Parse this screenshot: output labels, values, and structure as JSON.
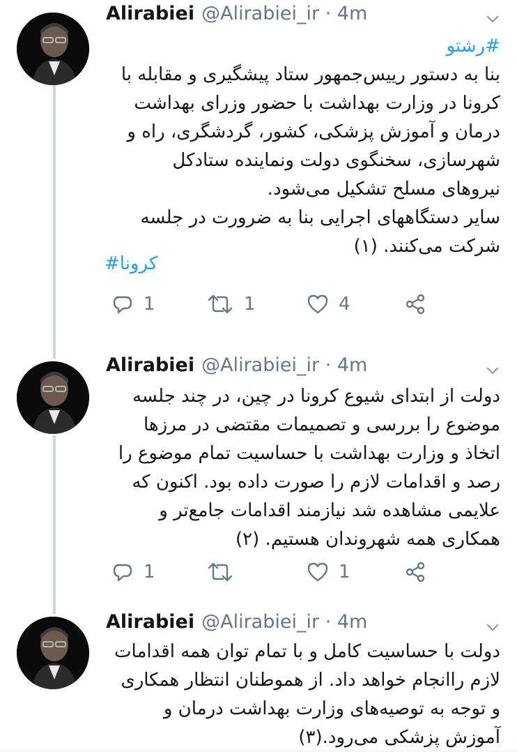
{
  "tweets": [
    {
      "name": "Alirabiei",
      "handle": "@Alirabiei_ir · 4m",
      "hashtag_top": "#رشتو",
      "lines": [
        "بنا به دستور رییس‌جمهور ستاد پیشگیری و مقابله با",
        "کرونا در وزارت بهداشت با حضور وزرای بهداشت",
        "درمان و آموزش پزشکی، کشور، گردشگری، راه و",
        "شهرسازی، سخنگوی دولت ونماینده ستادکل",
        "نیروهای مسلح تشکیل می‌شود.",
        "سایر دستگاههای اجرایی بنا به ضرورت در جلسه",
        "شرکت می‌کنند. (۱)"
      ],
      "hashtag_bottom": "#کرونا",
      "reply_count": "1",
      "retweet_count": "1",
      "like_count": "4"
    },
    {
      "name": "Alirabiei",
      "handle": "@Alirabiei_ir · 4m",
      "lines": [
        "دولت از ابتدای شیوع کرونا در چین، در چند جلسه",
        "موضوع را بررسی و تصمیمات مقتضی در مرزها",
        "اتخاذ و وزارت بهداشت با حساسیت تمام موضوع را",
        "رصد و اقدامات لازم را صورت داده بود. اکنون که",
        "علایمی مشاهده شد نیازمند اقدامات جامع‌تر و",
        "همکاری همه شهروندان هستیم. (۲)"
      ],
      "reply_count": "1",
      "retweet_count": "",
      "like_count": "1"
    },
    {
      "name": "Alirabiei",
      "handle": "@Alirabiei_ir · 4m",
      "lines": [
        "دولت با حساسیت کامل و با تمام توان همه اقدامات",
        "لازم راانجام خواهد داد. از هموطنان انتظار همکاری",
        "و توجه به توصیه‌های وزارت بهداشت درمان و",
        "آموزش پزشکی می‌رود.(۳)"
      ]
    }
  ],
  "icons": {
    "reply": "reply-icon",
    "retweet": "retweet-icon",
    "like": "like-icon",
    "share": "share-icon",
    "more": "chevron-down-icon"
  },
  "colors": {
    "accent": "#1da1f2",
    "muted": "#657786",
    "text": "#14171a",
    "thread_line": "#ccd6dd"
  }
}
